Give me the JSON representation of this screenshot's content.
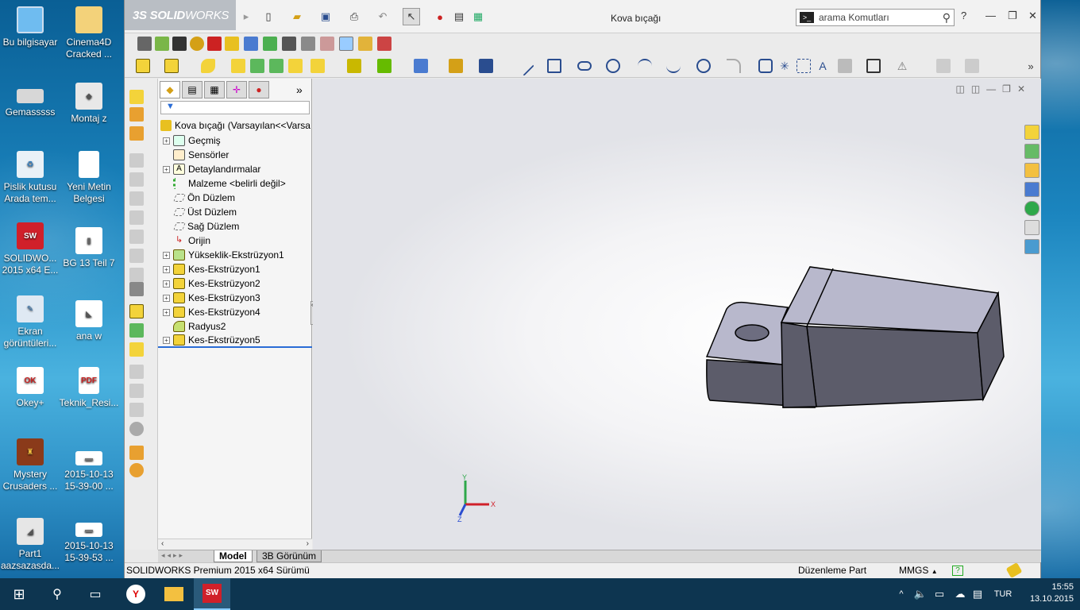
{
  "desktop_icons": [
    {
      "label": "Bu bilgisayar",
      "icon": "computer-icon"
    },
    {
      "label": "Cinema4D Cracked ...",
      "icon": "folder-icon"
    },
    {
      "label": "Gemasssss",
      "icon": "drive-icon"
    },
    {
      "label": "Montaj z",
      "icon": "assembly-file-icon"
    },
    {
      "label": "Pislik kutusu Arada tem...",
      "icon": "recycle-bin-icon"
    },
    {
      "label": "Yeni Metin Belgesi",
      "icon": "text-document-icon"
    },
    {
      "label": "SOLIDWO... 2015 x64 E...",
      "icon": "solidworks-icon"
    },
    {
      "label": "BG 13 Teil 7",
      "icon": "part-file-icon"
    },
    {
      "label": "Ekran görüntüleri...",
      "icon": "screenshot-folder-icon"
    },
    {
      "label": "ana w",
      "icon": "part-file-icon"
    },
    {
      "label": "Okey+",
      "icon": "okey-game-icon"
    },
    {
      "label": "Teknik_Resi...",
      "icon": "pdf-icon"
    },
    {
      "label": "Mystery Crusaders ...",
      "icon": "game-icon"
    },
    {
      "label": "2015-10-13 15-39-00 ...",
      "icon": "image-file-icon"
    },
    {
      "label": "Part1 aazsazasda...",
      "icon": "part-file-icon"
    },
    {
      "label": "2015-10-13 15-39-53 ...",
      "icon": "image-file-icon"
    }
  ],
  "app": {
    "logo_a": "3S SOLID",
    "logo_b": "WORKS",
    "window_title": "Kova bıçağı",
    "search_placeholder": "arama Komutları",
    "help_label": "?"
  },
  "tree": {
    "filter_icon": "filter-icon",
    "root": "Kova bıçağı  (Varsayılan<<Varsa",
    "items": [
      {
        "label": "Geçmiş",
        "expandable": true,
        "icon": "history-icon"
      },
      {
        "label": "Sensörler",
        "expandable": false,
        "icon": "sensor-icon"
      },
      {
        "label": "Detaylandırmalar",
        "expandable": true,
        "icon": "annotations-icon"
      },
      {
        "label": "Malzeme <belirli değil>",
        "expandable": false,
        "icon": "material-icon"
      },
      {
        "label": "Ön Düzlem",
        "expandable": false,
        "icon": "plane-icon"
      },
      {
        "label": "Üst Düzlem",
        "expandable": false,
        "icon": "plane-icon"
      },
      {
        "label": "Sağ Düzlem",
        "expandable": false,
        "icon": "plane-icon"
      },
      {
        "label": "Orijin",
        "expandable": false,
        "icon": "origin-icon"
      },
      {
        "label": "Yükseklik-Ekstrüzyon1",
        "expandable": true,
        "icon": "boss-extrude-icon"
      },
      {
        "label": "Kes-Ekstrüzyon1",
        "expandable": true,
        "icon": "cut-extrude-icon"
      },
      {
        "label": "Kes-Ekstrüzyon2",
        "expandable": true,
        "icon": "cut-extrude-icon"
      },
      {
        "label": "Kes-Ekstrüzyon3",
        "expandable": true,
        "icon": "cut-extrude-icon"
      },
      {
        "label": "Kes-Ekstrüzyon4",
        "expandable": true,
        "icon": "cut-extrude-icon"
      },
      {
        "label": "Radyus2",
        "expandable": false,
        "icon": "fillet-icon"
      },
      {
        "label": "Kes-Ekstrüzyon5",
        "expandable": true,
        "icon": "cut-extrude-icon"
      }
    ]
  },
  "view": {
    "triad_x": "X",
    "triad_y": "Y",
    "triad_z": "Z"
  },
  "tabs": [
    "Model",
    "3B Görünüm"
  ],
  "status": {
    "product": "SOLIDWORKS Premium 2015 x64 Sürümü",
    "mode": "Düzenleme Part",
    "units": "MMGS",
    "units_arrow": "▲"
  },
  "taskbar": {
    "language": "TUR",
    "time": "15:55",
    "date": "13.10.2015"
  },
  "colors": {
    "extrude_icon": "#f3d33a",
    "part_face_light": "#b8b8cc",
    "part_face_dark": "#5c5c6a",
    "taskbar": "#0d3550"
  }
}
